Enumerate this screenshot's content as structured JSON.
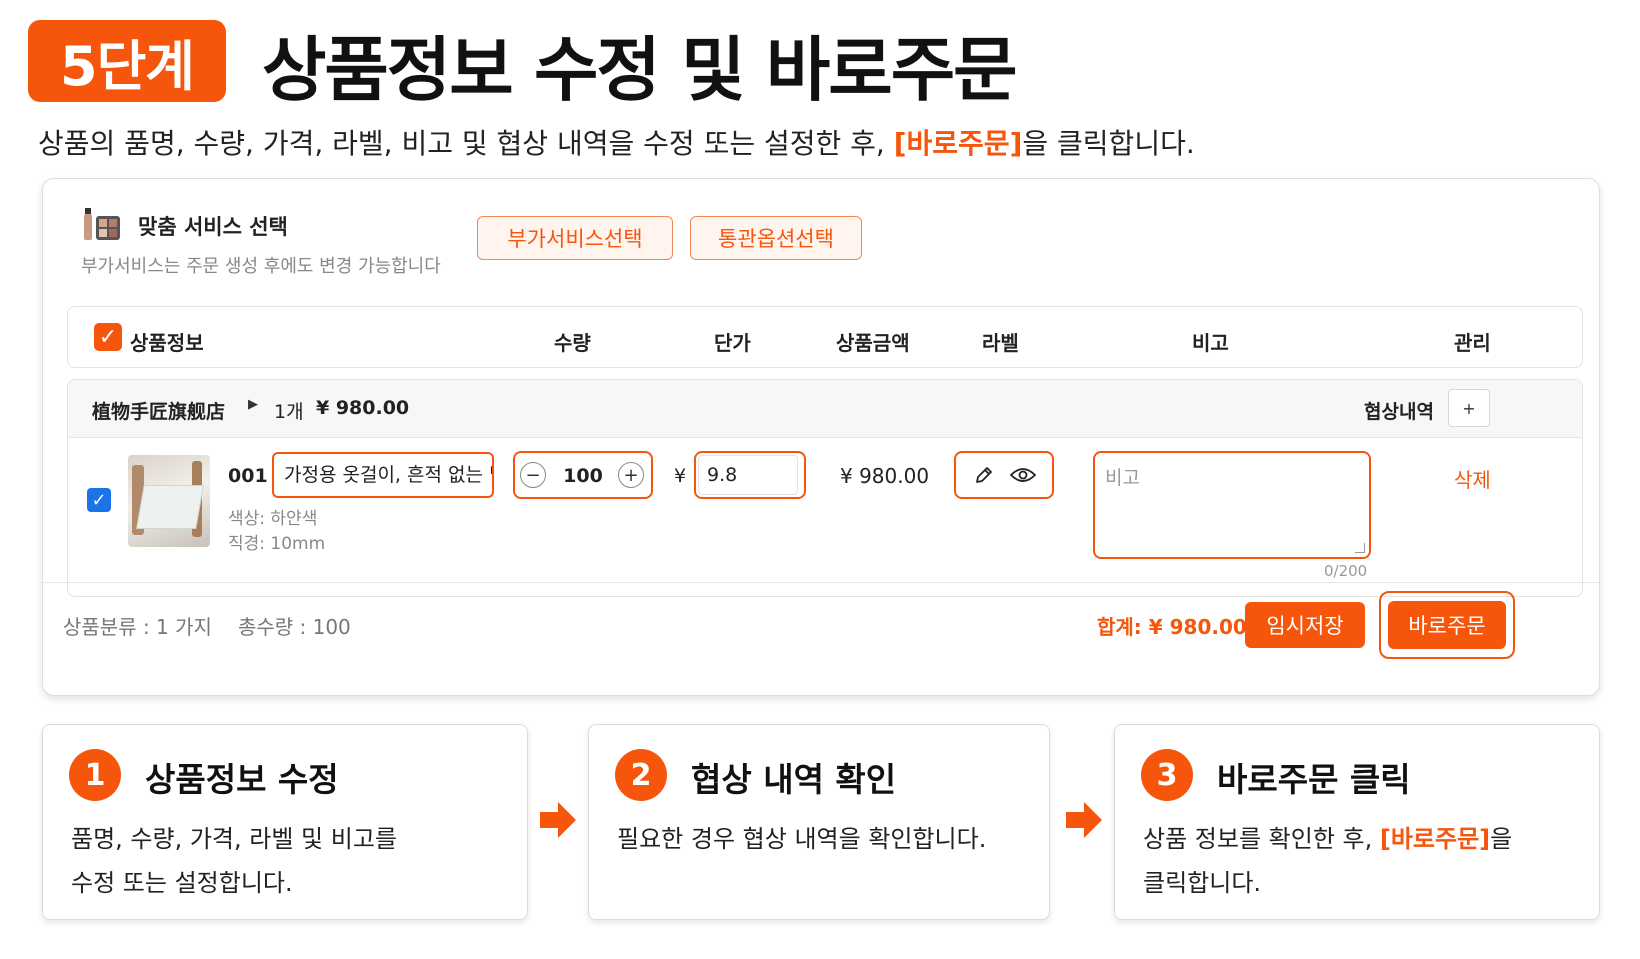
{
  "header": {
    "step_badge": "5단계",
    "title": "상품정보 수정 및 바로주문",
    "subtitle_prefix": "상품의 품명, 수량, 가격, 라벨, 비고 및 협상 내역을 수정 또는 설정한 후, ",
    "subtitle_highlight": "[바로주문]",
    "subtitle_suffix": "을 클릭합니다."
  },
  "service": {
    "title": "맞춤 서비스 선택",
    "desc": "부가서비스는 주문 생성 후에도 변경 가능합니다",
    "btn_addon": "부가서비스선택",
    "btn_customs": "통관옵션선택"
  },
  "table_header": {
    "product": "상품정보",
    "qty": "수량",
    "unit_price": "단가",
    "amount": "상품금액",
    "label": "라벨",
    "memo": "비고",
    "manage": "관리"
  },
  "shop": {
    "name": "植物手匠旗舰店",
    "count": "1개",
    "total": "¥ 980.00",
    "nego_label": "협상내역",
    "nego_plus": "+"
  },
  "item": {
    "sku": "001",
    "name_value": "가정용 옷걸이, 흔적 없는 넓",
    "attr_color": "색상: 하얀색",
    "attr_size": "직경: 10mm",
    "qty_minus": "−",
    "qty_value": "100",
    "qty_plus": "+",
    "yen": "¥",
    "price_value": "9.8",
    "amount": "¥ 980.00",
    "memo_placeholder": "비고",
    "memo_count": "0/200",
    "delete": "삭제"
  },
  "footer": {
    "category_count": "상품분류 : 1 가지",
    "total_qty": "총수량 : 100",
    "sum": "합계: ¥ 980.00",
    "btn_save": "임시저장",
    "btn_order": "바로주문"
  },
  "cards": [
    {
      "num": "1",
      "title": "상품정보 수정",
      "line1": "품명, 수량, 가격, 라벨 및 비고를",
      "line2": "수정 또는 설정합니다."
    },
    {
      "num": "2",
      "title": "협상 내역 확인",
      "line1": "필요한 경우 협상 내역을 확인합니다."
    },
    {
      "num": "3",
      "title": "바로주문 클릭",
      "line1_prefix": "상품 정보를 확인한 후, ",
      "line1_highlight": "[바로주문]",
      "line1_suffix": "을",
      "line2": "클릭합니다."
    }
  ],
  "colors": {
    "accent": "#f5560c",
    "checkbox_blue": "#1a73e8"
  }
}
